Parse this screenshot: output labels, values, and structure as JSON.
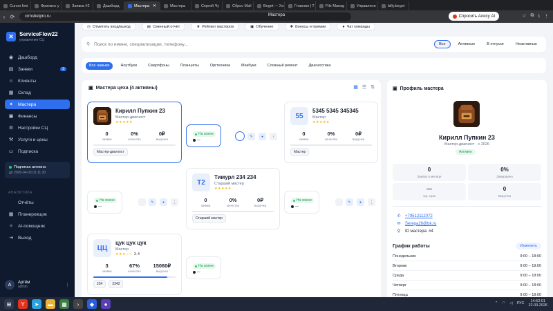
{
  "browser": {
    "tabs": [
      {
        "label": "Cursor limi"
      },
      {
        "label": "Фриланс у"
      },
      {
        "label": "Заявка #2"
      },
      {
        "label": "Дашборд"
      },
      {
        "label": "Мастера",
        "active": true
      },
      {
        "label": "Мастера"
      },
      {
        "label": "Сергей Чу"
      },
      {
        "label": "Сброс Mail"
      },
      {
        "label": "Beget — Хо"
      },
      {
        "label": "Главная | Т"
      },
      {
        "label": "File Manag"
      },
      {
        "label": "Управлени"
      },
      {
        "label": "billy.beget"
      }
    ],
    "url": "crmsbetpro.ru",
    "page_title": "Мастера",
    "alice_label": "Спросить Алису AI"
  },
  "sidebar": {
    "brand_name": "ServiceFlow22",
    "brand_sub": "управление СЦ",
    "items": [
      {
        "label": "Дашборд",
        "icon": "dashboard-icon"
      },
      {
        "label": "Заявки",
        "icon": "tickets-icon",
        "badge": "3"
      },
      {
        "label": "Клиенты",
        "icon": "clients-icon"
      },
      {
        "label": "Склад",
        "icon": "warehouse-icon"
      },
      {
        "label": "Мастера",
        "icon": "masters-icon",
        "active": true
      },
      {
        "label": "Финансы",
        "icon": "finance-icon"
      },
      {
        "label": "Настройки СЦ",
        "icon": "settings-icon"
      },
      {
        "label": "Услуги и цены",
        "icon": "services-icon"
      },
      {
        "label": "Подписка",
        "icon": "subscription-icon"
      }
    ],
    "subscription": {
      "title": "Подписка активна",
      "until": "до 2026-04-03 01:11:30"
    },
    "section_label": "АНАЛИТИКА",
    "items2": [
      {
        "label": "Отчёты"
      },
      {
        "label": "Планировщик"
      },
      {
        "label": "AI-помощник"
      },
      {
        "label": "Выход"
      }
    ],
    "user": {
      "initial": "A",
      "name": "Артём",
      "role": "admin"
    }
  },
  "toolbar": {
    "buttons": [
      "Отметить вход/выход",
      "Сменный отчёт",
      "Рейтинг мастеров",
      "Обучение",
      "Бонусы и премии",
      "Чат команды"
    ]
  },
  "search": {
    "placeholder": "Поиск по имени, специализации, телефону...",
    "filters": [
      "Все",
      "Активные",
      "В отпуске",
      "Неактивные"
    ]
  },
  "skills": [
    "Все навыки",
    "Ноутбуки",
    "Смартфоны",
    "Планшеты",
    "Оргтехника",
    "Макбуки",
    "Сложный ремонт",
    "Диагностика"
  ],
  "masters_panel": {
    "title": "Мастера цеха (4 активны)",
    "stat_labels": [
      "заявки",
      "качество",
      "выручка"
    ],
    "cards": [
      {
        "name": "Кирилл Пупкин 23",
        "role": "Мастер-диагност",
        "stars": "★★★★★",
        "rating": "",
        "stats": [
          "0",
          "0%",
          "0₽"
        ],
        "tags": [
          "Мастер-диагност"
        ],
        "avatar": "",
        "progress": 0
      },
      {
        "name": "5345 5345 345345",
        "role": "Мастер",
        "stars": "★★★★★",
        "rating": "",
        "stats": [
          "0",
          "0%",
          "0₽"
        ],
        "tags": [
          "Мастер"
        ],
        "avatar": "55",
        "progress": 0
      },
      {
        "name": "Тимурл 234 234",
        "role": "Старший мастер",
        "stars": "★★★★★",
        "rating": "",
        "stats": [
          "0",
          "0%",
          "0₽"
        ],
        "tags": [
          "Старший мастер"
        ],
        "avatar": "Т2",
        "progress": 0
      },
      {
        "name": "цук цук цук",
        "role": "Мастер",
        "stars": "★★★☆☆",
        "rating": "3.4",
        "stats": [
          "3",
          "67%",
          "15080₽"
        ],
        "tags": [
          "234",
          "2342"
        ],
        "avatar": "ЦЦ",
        "progress": 0.9
      }
    ],
    "shift_label": "На смене",
    "shift_dash": "—"
  },
  "profile": {
    "title": "Профиль мастера",
    "name": "Кирилл Пупкин 23",
    "role_line": "Мастер-диагност · с 2026",
    "status": "Активен",
    "stats": [
      {
        "value": "0",
        "label": "Заявок в месяце"
      },
      {
        "value": "0%",
        "label": "Завершено"
      },
      {
        "value": "—",
        "label": "Ср. срок"
      },
      {
        "value": "0",
        "label": "Выручка"
      }
    ],
    "phone": "+79512112072",
    "email": "Serega26@bk.ru",
    "master_id": "ID мастера: #4",
    "schedule_title": "График работы",
    "schedule_edit": "Изменить",
    "schedule": [
      {
        "day": "Понедельник",
        "time": "9:00 – 18:00"
      },
      {
        "day": "Вторник",
        "time": "9:00 – 18:00"
      },
      {
        "day": "Среда",
        "time": "9:00 – 18:00"
      },
      {
        "day": "Четверг",
        "time": "9:00 – 18:00"
      },
      {
        "day": "Пятница",
        "time": "9:00 – 18:00"
      }
    ]
  },
  "taskbar": {
    "lang": "РУС",
    "time": "14:52:01",
    "date": "22.03.2026"
  }
}
